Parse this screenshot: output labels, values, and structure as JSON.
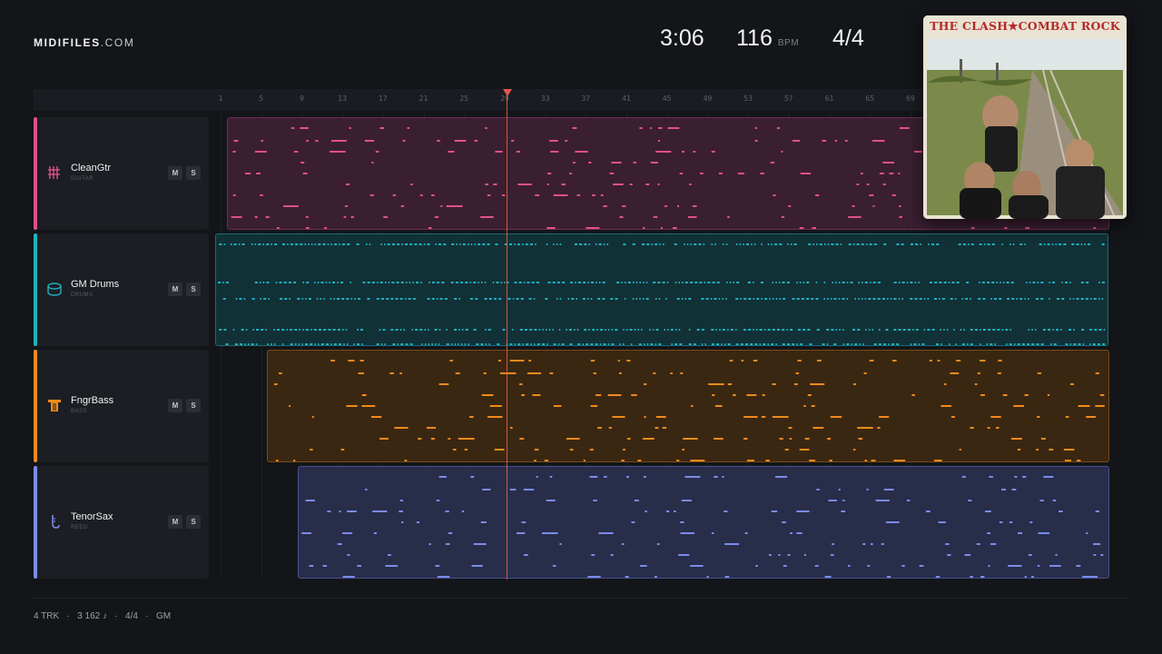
{
  "app": {
    "logo_bold": "MIDIFILES",
    "logo_light": ".COM"
  },
  "transport": {
    "time": "3:06",
    "tempo": "116",
    "tempo_unit": "BPM",
    "signature": "4/4"
  },
  "ruler": {
    "ticks": [
      "1",
      "5",
      "9",
      "13",
      "17",
      "21",
      "25",
      "29",
      "33",
      "37",
      "41",
      "45",
      "49",
      "53",
      "57",
      "61",
      "65",
      "69"
    ]
  },
  "tracks": [
    {
      "name": "CleanGtr",
      "type": "GUITAR",
      "color": "#e0508a",
      "icon": "guitar-icon",
      "mute": "M",
      "solo": "S"
    },
    {
      "name": "GM Drums",
      "type": "DRUMS",
      "color": "#1fb3bf",
      "icon": "drum-icon",
      "mute": "M",
      "solo": "S"
    },
    {
      "name": "FngrBass",
      "type": "BASS",
      "color": "#f08a1c",
      "icon": "bass-icon",
      "mute": "M",
      "solo": "S"
    },
    {
      "name": "TenorSax",
      "type": "REED",
      "color": "#7a8ce8",
      "icon": "sax-icon",
      "mute": "M",
      "solo": "S"
    }
  ],
  "album": {
    "title": "THE CLASH★COMBAT ROCK"
  },
  "footer": {
    "tracks": "4 TRK",
    "notes": "3 162 ♪",
    "signature": "4/4",
    "standard": "GM",
    "sep": "·"
  }
}
